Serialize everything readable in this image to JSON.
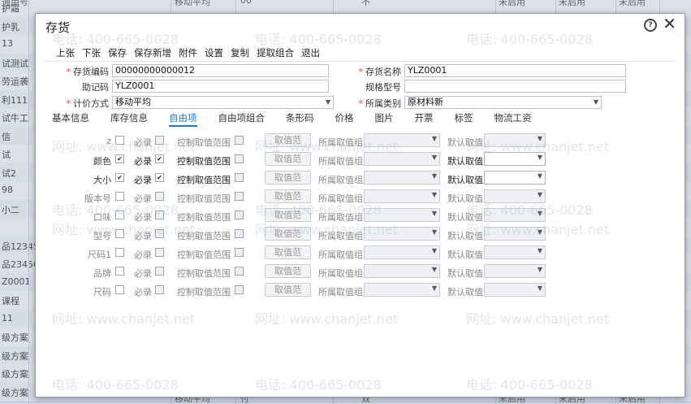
{
  "background": {
    "top_cells": [
      "通用号",
      "移动平均",
      "00",
      "不",
      "未启用",
      "未启用",
      "未启用"
    ],
    "left_column": [
      "护霜",
      "护乳",
      "13",
      "试测试",
      "劳运袭",
      "利111",
      "试牛工",
      "信",
      "试",
      "试2",
      "98",
      "小二",
      "",
      "品12345",
      "品23456",
      "Z0001",
      "课程",
      "11",
      "级方案",
      "级方案",
      "级方案",
      "级方案"
    ],
    "bottom_cells": [
      "移动平均",
      "付",
      "双",
      "未启用",
      "未启用",
      "未启用",
      "未启用"
    ]
  },
  "dialog": {
    "title": "存货",
    "toolbar": [
      "上张",
      "下张",
      "保存",
      "保存新增",
      "附件",
      "设置",
      "复制",
      "提取组合",
      "退出"
    ],
    "form": {
      "code_label": "存货编码",
      "code_value": "00000000000012",
      "name_label": "存货名称",
      "name_value": "YLZ0001",
      "mnemonic_label": "助记码",
      "mnemonic_value": "YLZ0001",
      "spec_label": "规格型号",
      "spec_value": "",
      "costing_label": "计价方式",
      "costing_value": "移动平均",
      "category_label": "所属类别",
      "category_value": "原材料新"
    },
    "tabs": [
      "基本信息",
      "库存信息",
      "自由项",
      "自由项组合",
      "条形码",
      "价格",
      "图片",
      "开票",
      "标签",
      "物流工资"
    ],
    "active_tab": "自由项",
    "free_items": {
      "required_label": "必录",
      "control_label": "控制取值范围",
      "button_label": "取值范",
      "group_label": "所属取值组",
      "default_label": "默认取值",
      "rows": [
        {
          "name": "z",
          "enabled": false,
          "required": false,
          "control": false
        },
        {
          "name": "颜色",
          "enabled": true,
          "required": true,
          "control": false
        },
        {
          "name": "大小",
          "enabled": true,
          "required": true,
          "control": false
        },
        {
          "name": "版本号",
          "enabled": false,
          "required": false,
          "control": false
        },
        {
          "name": "口味",
          "enabled": false,
          "required": false,
          "control": false
        },
        {
          "name": "型号",
          "enabled": false,
          "required": false,
          "control": false
        },
        {
          "name": "尺码1",
          "enabled": false,
          "required": false,
          "control": false
        },
        {
          "name": "品牌",
          "enabled": false,
          "required": false,
          "control": false
        },
        {
          "name": "尺码",
          "enabled": false,
          "required": false,
          "control": false
        }
      ]
    }
  },
  "watermark": {
    "phone": "电话: 400-665-0028",
    "url": "网址: www.chanjet.net"
  },
  "colors": {
    "accent": "#1e78d8",
    "required_star": "#e0433c"
  }
}
